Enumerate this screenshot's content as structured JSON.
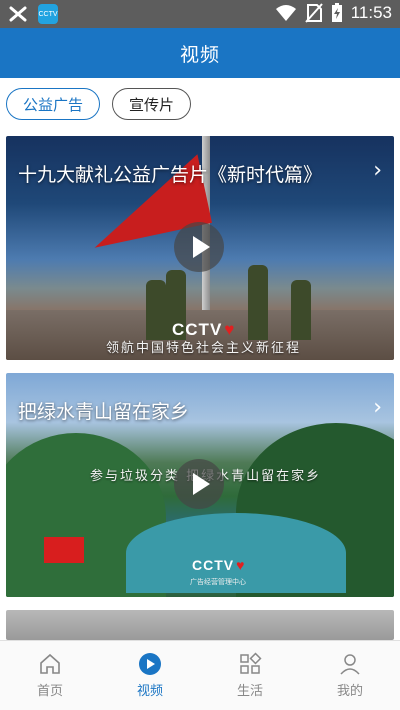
{
  "status_bar": {
    "time": "11:53",
    "app_icon_label": "CCTV",
    "icons": [
      "notification-icon",
      "app-icon",
      "wifi-icon",
      "no-sim-icon",
      "battery-charging-icon"
    ]
  },
  "header": {
    "title": "视频"
  },
  "filters": [
    {
      "label": "公益广告",
      "active": true
    },
    {
      "label": "宣传片",
      "active": false
    }
  ],
  "videos": [
    {
      "title": "十九大献礼公益广告片《新时代篇》",
      "caption": "领航中国特色社会主义新征程",
      "logo": "CCTV",
      "logo_heart": "♥"
    },
    {
      "title": "把绿水青山留在家乡",
      "caption": "参与垃圾分类  把绿水青山留在家乡",
      "logo": "CCTV",
      "logo_heart": "♥",
      "sub_logo": "广告经营管理中心"
    }
  ],
  "bottom_nav": [
    {
      "label": "首页",
      "icon": "home-icon",
      "active": false
    },
    {
      "label": "视频",
      "icon": "video-play-icon",
      "active": true
    },
    {
      "label": "生活",
      "icon": "life-grid-icon",
      "active": false
    },
    {
      "label": "我的",
      "icon": "profile-icon",
      "active": false
    }
  ],
  "colors": {
    "primary": "#1a75c4",
    "status_bar": "#5d5d5d",
    "inactive": "#888888"
  }
}
